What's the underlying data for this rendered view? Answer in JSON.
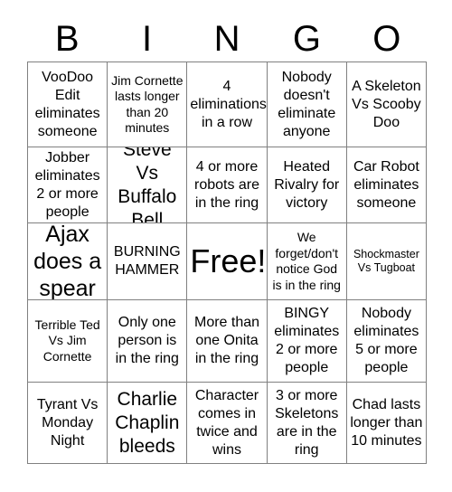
{
  "card": {
    "headers": [
      "B",
      "I",
      "N",
      "G",
      "O"
    ],
    "rows": [
      [
        {
          "text": "VooDoo Edit eliminates someone",
          "size": "t-md"
        },
        {
          "text": "Jim Cornette lasts longer than 20 minutes",
          "size": "t-sm"
        },
        {
          "text": "4 eliminations in a row",
          "size": "t-md"
        },
        {
          "text": "Nobody doesn't eliminate anyone",
          "size": "t-md"
        },
        {
          "text": "A Skeleton Vs Scooby Doo",
          "size": "t-md"
        }
      ],
      [
        {
          "text": "Jobber eliminates 2 or more people",
          "size": "t-md"
        },
        {
          "text": "Steve Vs Buffalo Bell",
          "size": "t-lg"
        },
        {
          "text": "4 or more robots are in the ring",
          "size": "t-md"
        },
        {
          "text": "Heated Rivalry for victory",
          "size": "t-md"
        },
        {
          "text": "Car Robot eliminates someone",
          "size": "t-md"
        }
      ],
      [
        {
          "text": "Ajax does a spear",
          "size": "t-xl"
        },
        {
          "text": "BURNING HAMMER",
          "size": "t-md"
        },
        {
          "text": "Free!",
          "size": "t-free"
        },
        {
          "text": "We forget/don't notice God is in the ring",
          "size": "t-sm"
        },
        {
          "text": "Shockmaster Vs Tugboat",
          "size": "t-xs"
        }
      ],
      [
        {
          "text": "Terrible Ted Vs Jim Cornette",
          "size": "t-sm"
        },
        {
          "text": "Only one person is in the ring",
          "size": "t-md"
        },
        {
          "text": "More than one Onita in the ring",
          "size": "t-md"
        },
        {
          "text": "BINGY eliminates 2 or more people",
          "size": "t-md"
        },
        {
          "text": "Nobody eliminates 5 or more people",
          "size": "t-md"
        }
      ],
      [
        {
          "text": "Tyrant Vs Monday Night",
          "size": "t-md"
        },
        {
          "text": "Charlie Chaplin bleeds",
          "size": "t-lg"
        },
        {
          "text": "Character comes in twice and wins",
          "size": "t-md"
        },
        {
          "text": "3 or more Skeletons are in the ring",
          "size": "t-md"
        },
        {
          "text": "Chad lasts longer than 10 minutes",
          "size": "t-md"
        }
      ]
    ]
  },
  "colors": {
    "border": "#808080",
    "text": "#000000",
    "background": "#ffffff"
  }
}
